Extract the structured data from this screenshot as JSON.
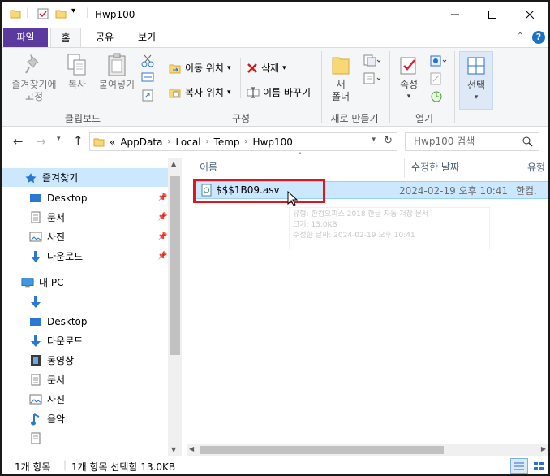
{
  "window": {
    "title": "Hwp100"
  },
  "tabs": {
    "file": "파일",
    "home": "홈",
    "share": "공유",
    "view": "보기"
  },
  "ribbon": {
    "clipboard": {
      "pin_label_1": "즐겨찾기에",
      "pin_label_2": "고정",
      "copy": "복사",
      "paste": "붙여넣기",
      "group": "클립보드"
    },
    "organize": {
      "move_to": "이동 위치",
      "copy_to": "복사 위치",
      "delete": "삭제",
      "rename": "이름 바꾸기",
      "group": "구성"
    },
    "new": {
      "new_folder_1": "새",
      "new_folder_2": "폴더",
      "group": "새로 만들기"
    },
    "open": {
      "properties": "속성",
      "group": "열기"
    },
    "select": {
      "label": "선택"
    }
  },
  "address": {
    "prefix": "«",
    "crumbs": [
      "AppData",
      "Local",
      "Temp",
      "Hwp100"
    ],
    "search_placeholder": "Hwp100 검색"
  },
  "nav": {
    "quick_access": "즐겨찾기",
    "desktop": "Desktop",
    "documents": "문서",
    "pictures": "사진",
    "downloads": "다운로드",
    "this_pc": "내 PC",
    "pc_desktop": "Desktop",
    "pc_downloads": "다운로드",
    "pc_videos": "동영상",
    "pc_documents": "문서",
    "pc_pictures": "사진",
    "pc_music": "음악"
  },
  "columns": {
    "name": "이름",
    "modified": "수정한 날짜",
    "type": "유형"
  },
  "files": [
    {
      "name": "$$$1B09.asv",
      "modified": "2024-02-19 오후 10:41",
      "type": "한컴."
    }
  ],
  "tooltip": {
    "line1": "유형: 한컴오피스 2018 한글 자동 저장 문서",
    "line2": "크기: 13.0KB",
    "line3": "수정한 날짜: 2024-02-19 오후 10:41"
  },
  "status": {
    "count": "1개 항목",
    "selected": "1개 항목 선택함 13.0KB"
  }
}
